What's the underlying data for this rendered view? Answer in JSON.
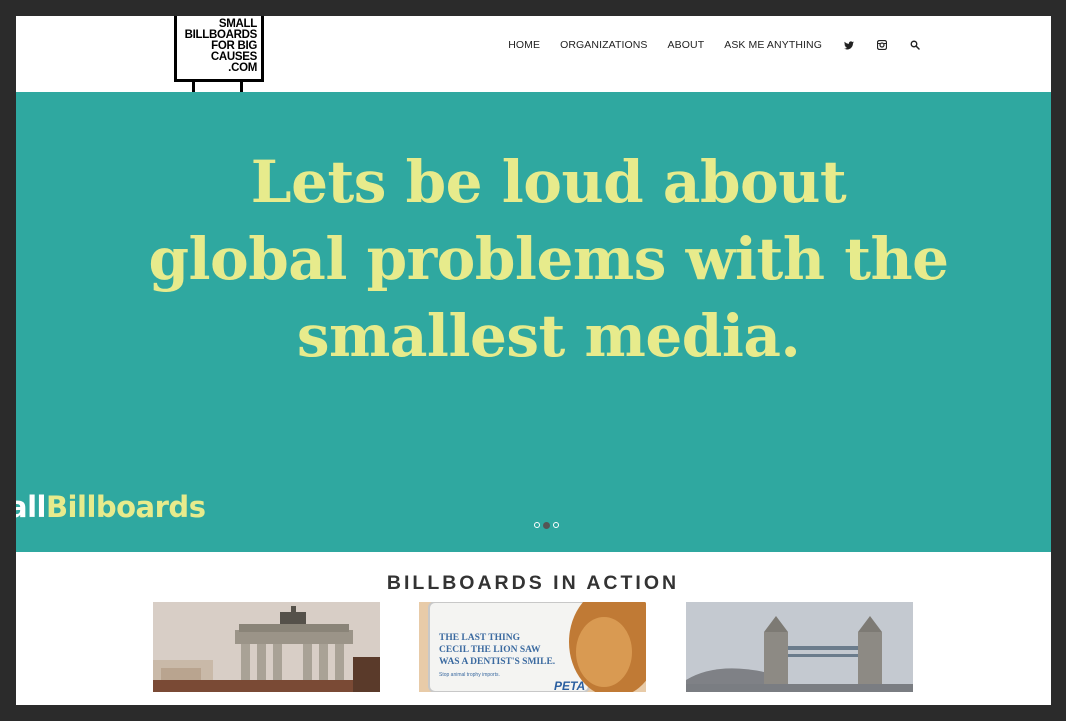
{
  "logo": {
    "lines": [
      "SMALL",
      "BILLBOARDS",
      "FOR BIG",
      "CAUSES",
      ".COM"
    ]
  },
  "nav": {
    "items": [
      "HOME",
      "ORGANIZATIONS",
      "ABOUT",
      "ASK ME ANYTHING"
    ],
    "icons": [
      "twitter-icon",
      "instagram-icon",
      "search-icon"
    ]
  },
  "hero": {
    "headline_lines": [
      "Lets be loud about",
      "global problems with the",
      "smallest media."
    ],
    "hashtag_white": "all",
    "hashtag_yellow": "Billboards",
    "slides_count": 3,
    "active_slide": 2,
    "background_color": "#2fa8a0",
    "text_color": "#e7eb8c"
  },
  "section": {
    "title": "BILLBOARDS IN ACTION"
  },
  "thumbnails": {
    "t2_lines": [
      "THE LAST THING",
      "CECIL THE LION SAW",
      "WAS A DENTIST'S SMILE."
    ],
    "t2_sub": "Stop animal trophy imports.",
    "t2_brand": "PETA"
  }
}
